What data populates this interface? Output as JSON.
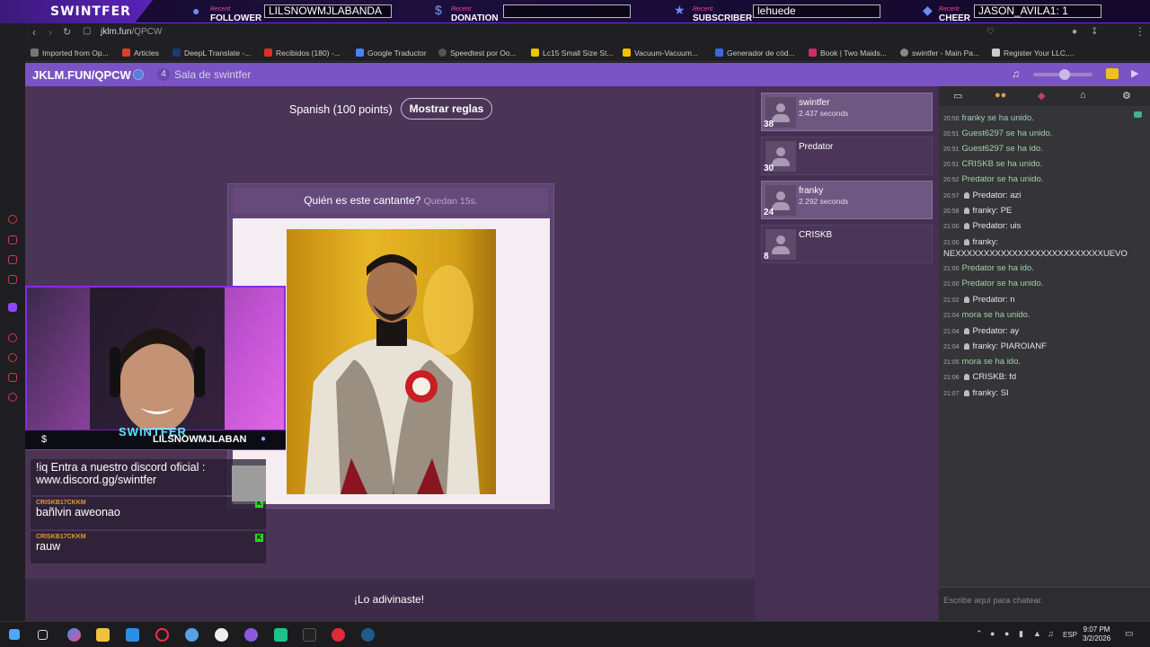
{
  "overlay": {
    "brand": "SWINTFER",
    "recent_label": "Recent",
    "follower_label": "FOLLOWER",
    "follower_value": "LILSNOWMJLABANDA",
    "donation_label": "DONATION",
    "donation_value": "",
    "subscriber_label": "SUBSCRIBER",
    "subscriber_value": "lehuede",
    "cheer_label": "CHEER",
    "cheer_value": "JASON_AVILA1: 1"
  },
  "browser": {
    "url_host": "jklm.fun",
    "url_path": "/QPCW",
    "bookmarks": [
      "Imported from Op...",
      "Articles",
      "DeepL Translate -...",
      "Recibidos (180) -...",
      "Google Traductor",
      "Speedtest por Oo...",
      "Lc15 Small Size St...",
      "Vacuum-Vacuum...",
      "Generador de cód...",
      "Book | Two Maids...",
      "swintfer - Main Pa...",
      "Register Your LLC,..."
    ]
  },
  "site": {
    "room_code": "JKLM.FUN/QPCW",
    "player_count": "4",
    "room_name": "Sala de swintfer"
  },
  "game": {
    "language": "Spanish (100 points)",
    "rules_button": "Mostrar reglas",
    "question": "Quién es este cantante?",
    "time_left": "Quedan 15s.",
    "answer_status": "¡Lo adivinaste!"
  },
  "players": [
    {
      "name": "swintfer",
      "score": "38",
      "time": "2.437 seconds",
      "selected": true
    },
    {
      "name": "Predator",
      "score": "30",
      "time": "",
      "selected": false
    },
    {
      "name": "franky",
      "score": "24",
      "time": "2.292 seconds",
      "selected": true
    },
    {
      "name": "CRISKB",
      "score": "8",
      "time": "",
      "selected": false
    }
  ],
  "webcam": {
    "brand": "SWINTFER",
    "name": "LILSNOWMJLABAN"
  },
  "stream_chat": [
    {
      "user": "",
      "text": "!iq Entra a nuestro discord oficial : www.discord.gg/swintfer"
    },
    {
      "user": "CRISKB17CKKM",
      "text": "bañlvin aweonao"
    },
    {
      "user": "CRISKB17CKKM",
      "text": "rauw"
    }
  ],
  "chat": {
    "messages": [
      {
        "time": "20:50",
        "user": "",
        "text": "franky se ha unido.",
        "system": true
      },
      {
        "time": "20:51",
        "user": "",
        "text": "Guest6297 se ha unido.",
        "system": true
      },
      {
        "time": "20:51",
        "user": "",
        "text": "Guest6297 se ha ido.",
        "system": true
      },
      {
        "time": "20:51",
        "user": "",
        "text": "CRISKB se ha unido.",
        "system": true
      },
      {
        "time": "20:52",
        "user": "",
        "text": "Predator se ha unido.",
        "system": true
      },
      {
        "time": "20:57",
        "user": "Predator",
        "text": "azi",
        "system": false
      },
      {
        "time": "20:58",
        "user": "franky",
        "text": "PE",
        "system": false
      },
      {
        "time": "21:00",
        "user": "Predator",
        "text": "uis",
        "system": false
      },
      {
        "time": "21:00",
        "user": "franky",
        "text": "NEXXXXXXXXXXXXXXXXXXXXXXXXXXUEVO",
        "system": false
      },
      {
        "time": "21:00",
        "user": "",
        "text": "Predator se ha ido.",
        "system": true
      },
      {
        "time": "21:00",
        "user": "",
        "text": "Predator se ha unido.",
        "system": true
      },
      {
        "time": "21:02",
        "user": "Predator",
        "text": "n",
        "system": false
      },
      {
        "time": "21:04",
        "user": "",
        "text": "mora se ha unido.",
        "system": true
      },
      {
        "time": "21:04",
        "user": "Predator",
        "text": "ay",
        "system": false
      },
      {
        "time": "21:04",
        "user": "franky",
        "text": "PIAROIANF",
        "system": false
      },
      {
        "time": "21:05",
        "user": "",
        "text": "mora se ha ido.",
        "system": true
      },
      {
        "time": "21:06",
        "user": "CRISKB",
        "text": "fd",
        "system": false
      },
      {
        "time": "21:07",
        "user": "franky",
        "text": "SI",
        "system": false
      }
    ],
    "input_placeholder": "Escribe aquí para chatear."
  },
  "taskbar": {
    "lang": "ESP",
    "time": "9:07 PM",
    "date": "3/2/2026"
  }
}
